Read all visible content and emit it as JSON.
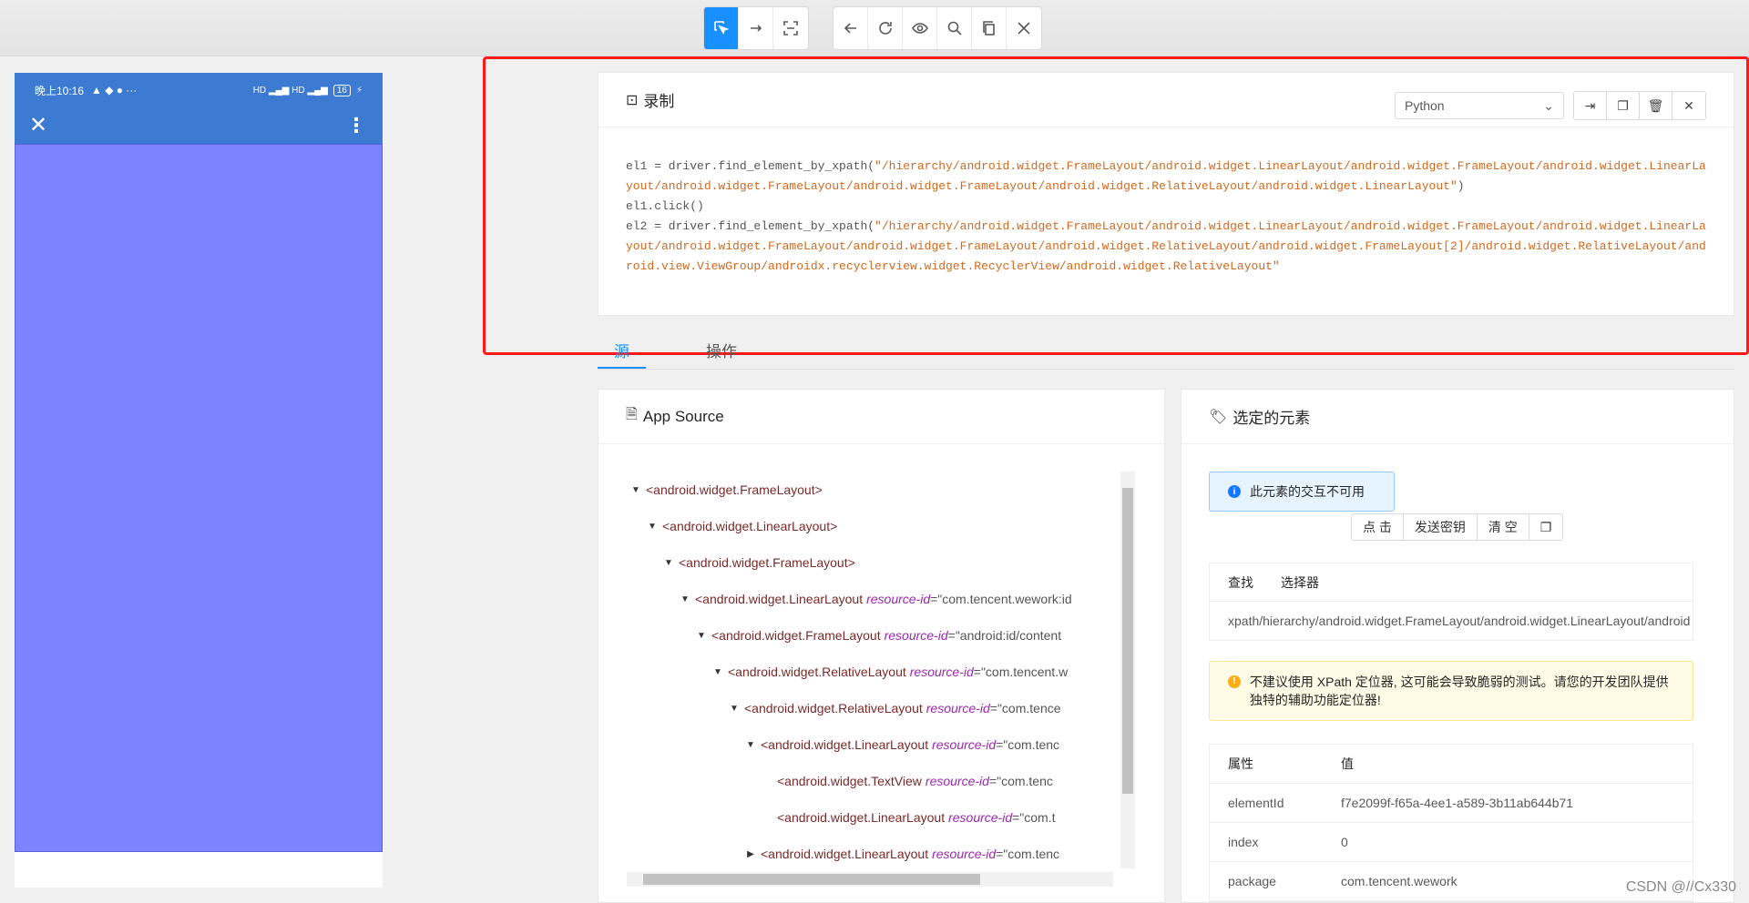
{
  "toolbar": {
    "group1": [
      "select-icon",
      "swipe-icon",
      "tap-by-coordinates-icon"
    ],
    "group2": [
      "back-icon",
      "refresh-icon",
      "eye-icon",
      "search-icon",
      "copy-icon",
      "close-icon"
    ]
  },
  "phone": {
    "time": "晚上10:16",
    "battery": "16"
  },
  "recorder": {
    "title": "录制",
    "language": "Python",
    "code_line1_prefix": "el1 = driver.find_element_by_xpath(",
    "code_line1_str": "\"/hierarchy/android.widget.FrameLayout/android.widget.LinearLayout/android.widget.FrameLayout/android.widget.LinearLayout/android.widget.FrameLayout/android.widget.FrameLayout/android.widget.RelativeLayout/android.widget.LinearLayout\"",
    "code_line1_suffix": ")",
    "code_line2": "el1.click()",
    "code_line3_prefix": "el2 = driver.find_element_by_xpath(",
    "code_line3_str": "\"/hierarchy/android.widget.FrameLayout/android.widget.LinearLayout/android.widget.FrameLayout/android.widget.LinearLayout/android.widget.FrameLayout/android.widget.FrameLayout/android.widget.RelativeLayout/android.widget.FrameLayout[2]/android.widget.RelativeLayout/android.view.ViewGroup/androidx.recyclerview.widget.RecyclerView/android.widget.RelativeLayout\""
  },
  "tabs": [
    "源",
    "操作"
  ],
  "source": {
    "title": "App Source",
    "nodes": [
      {
        "depth": 0,
        "caret": "▼",
        "tag": "<android.widget.FrameLayout>",
        "attr": "",
        "val": ""
      },
      {
        "depth": 1,
        "caret": "▼",
        "tag": "<android.widget.LinearLayout>",
        "attr": "",
        "val": ""
      },
      {
        "depth": 2,
        "caret": "▼",
        "tag": "<android.widget.FrameLayout>",
        "attr": "",
        "val": ""
      },
      {
        "depth": 3,
        "caret": "▼",
        "tag": "<android.widget.LinearLayout",
        "attr": "resource-id",
        "val": "=\"com.tencent.wework:id"
      },
      {
        "depth": 4,
        "caret": "▼",
        "tag": "<android.widget.FrameLayout",
        "attr": "resource-id",
        "val": "=\"android:id/content"
      },
      {
        "depth": 5,
        "caret": "▼",
        "tag": "<android.widget.RelativeLayout",
        "attr": "resource-id",
        "val": "=\"com.tencent.w"
      },
      {
        "depth": 6,
        "caret": "▼",
        "tag": "<android.widget.RelativeLayout",
        "attr": "resource-id",
        "val": "=\"com.tence"
      },
      {
        "depth": 7,
        "caret": "▼",
        "tag": "<android.widget.LinearLayout",
        "attr": "resource-id",
        "val": "=\"com.tenc"
      },
      {
        "depth": 8,
        "caret": "",
        "tag": "<android.widget.TextView",
        "attr": "resource-id",
        "val": "=\"com.tenc"
      },
      {
        "depth": 8,
        "caret": "",
        "tag": "<android.widget.LinearLayout",
        "attr": "resource-id",
        "val": "=\"com.t"
      },
      {
        "depth": 7,
        "caret": "▶",
        "tag": "<android.widget.LinearLayout",
        "attr": "resource-id",
        "val": "=\"com.tenc"
      }
    ]
  },
  "selected": {
    "title": "选定的元素",
    "info": "此元素的交互不可用",
    "actions": [
      "点 击",
      "发送密钥",
      "清 空"
    ],
    "find_headers": [
      "查找",
      "选择器"
    ],
    "find_row": [
      "xpath",
      "/hierarchy/android.widget.FrameLayout/android.widget.LinearLayout/android"
    ],
    "warning": "不建议使用 XPath 定位器, 这可能会导致脆弱的测试。请您的开发团队提供独特的辅助功能定位器!",
    "prop_headers": [
      "属性",
      "值"
    ],
    "props": [
      [
        "elementId",
        "f7e2099f-f65a-4ee1-a589-3b11ab644b71"
      ],
      [
        "index",
        "0"
      ],
      [
        "package",
        "com.tencent.wework"
      ]
    ]
  },
  "watermark": "CSDN @//Cx330"
}
